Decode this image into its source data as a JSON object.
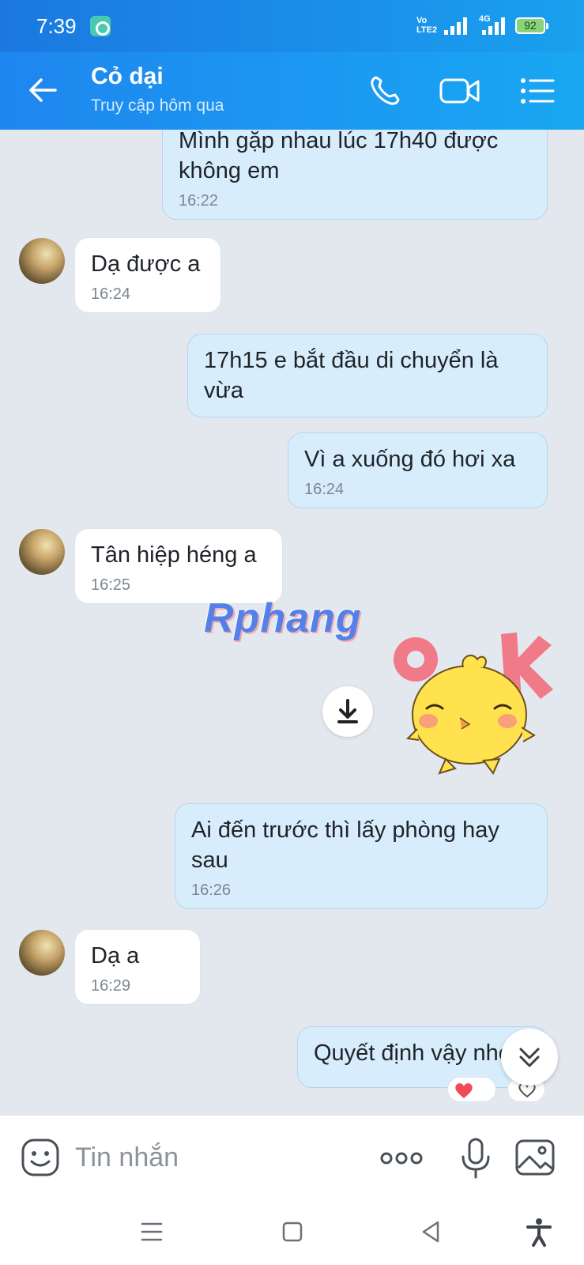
{
  "status_bar": {
    "time": "7:39",
    "volte": "Vo\nLTE2",
    "network": "4G",
    "battery": "92"
  },
  "header": {
    "contact_name": "Cỏ dại",
    "last_seen": "Truy cập hôm qua"
  },
  "messages": [
    {
      "side": "me",
      "text": "Mình gặp nhau lúc 17h40 được không em",
      "time": "16:22"
    },
    {
      "side": "them",
      "text": "Dạ được a",
      "time": "16:24"
    },
    {
      "side": "me",
      "text": "17h15 e bắt đầu di chuyển là vừa",
      "time": ""
    },
    {
      "side": "me",
      "text": "Vì a xuống đó hơi xa",
      "time": "16:24"
    },
    {
      "side": "them",
      "text": "Tân hiệp héng a",
      "time": "16:25"
    },
    {
      "side": "me",
      "text": "Ai đến trước thì lấy phòng hay sau",
      "time": "16:26"
    },
    {
      "side": "them",
      "text": "Dạ a",
      "time": "16:29"
    },
    {
      "side": "me",
      "text": "Quyết định vậy nhé",
      "time": ""
    }
  ],
  "watermark": "Rphang",
  "sticker": {
    "letters": "OK"
  },
  "input": {
    "placeholder": "Tin nhắn"
  },
  "colors": {
    "header_bg": "#1e86f0",
    "my_bubble": "#d7edfc",
    "their_bubble": "#ffffff",
    "chat_bg": "#e3e8ef"
  },
  "icons": [
    "back-arrow-icon",
    "phone-icon",
    "video-call-icon",
    "menu-list-icon",
    "download-icon",
    "emoji-icon",
    "more-icon",
    "microphone-icon",
    "image-icon",
    "scroll-down-icon",
    "heart-icon"
  ]
}
